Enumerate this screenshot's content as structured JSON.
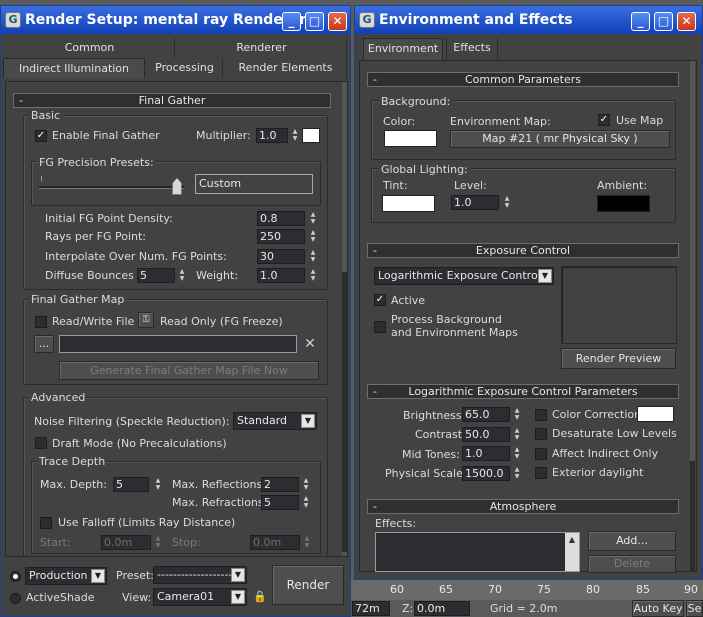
{
  "render_setup": {
    "title": "Render Setup: mental ray Renderer",
    "tabs": [
      "Common",
      "Renderer",
      "Indirect Illumination",
      "Processing",
      "Render Elements"
    ],
    "final_gather": {
      "header": "Final Gather",
      "basic_label": "Basic",
      "enable_label": "Enable Final Gather",
      "enable_checked": true,
      "multiplier_label": "Multiplier:",
      "multiplier_value": "1.0",
      "multiplier_color": "#ffffff",
      "presets_label": "FG Precision Presets:",
      "preset_value": "Custom",
      "preset_level": 1.0,
      "density_label": "Initial FG Point Density:",
      "density_value": "0.8",
      "rays_label": "Rays per FG Point:",
      "rays_value": "250",
      "interp_label": "Interpolate Over Num. FG Points:",
      "interp_value": "30",
      "bounces_label": "Diffuse Bounces",
      "bounces_value": "5",
      "weight_label": "Weight:",
      "weight_value": "1.0"
    },
    "fg_map": {
      "label": "Final Gather Map",
      "readwrite_label": "Read/Write File",
      "readonly_label": "Read Only (FG Freeze)",
      "browse_label": "...",
      "file_value": "",
      "generate_label": "Generate Final Gather Map File Now"
    },
    "advanced": {
      "label": "Advanced",
      "noise_label": "Noise Filtering (Speckle Reduction):",
      "noise_value": "Standard",
      "draft_label": "Draft Mode (No Precalculations)",
      "trace_label": "Trace Depth",
      "maxdepth_label": "Max. Depth:",
      "maxdepth_value": "5",
      "maxrefl_label": "Max. Reflections:",
      "maxrefl_value": "2",
      "maxrefr_label": "Max. Refractions:",
      "maxrefr_value": "5",
      "falloff_label": "Use Falloff (Limits Ray Distance)",
      "start_label": "Start:",
      "start_value": "0.0m",
      "stop_label": "Stop:",
      "stop_value": "0.0m"
    },
    "bottom": {
      "production_label": "Production",
      "activeshade_label": "ActiveShade",
      "preset_label": "Preset:",
      "preset_value": "--------------------",
      "view_label": "View:",
      "view_value": "Camera01",
      "render_label": "Render"
    }
  },
  "env_effects": {
    "title": "Environment and Effects",
    "tabs": [
      "Environment",
      "Effects"
    ],
    "common": {
      "header": "Common Parameters",
      "background_label": "Background:",
      "color_label": "Color:",
      "color_value": "#ffffff",
      "envmap_label": "Environment Map:",
      "usemap_label": "Use Map",
      "usemap_checked": true,
      "map_button": "Map #21  ( mr Physical Sky )",
      "global_label": "Global Lighting:",
      "tint_label": "Tint:",
      "tint_value": "#ffffff",
      "level_label": "Level:",
      "level_value": "1.0",
      "ambient_label": "Ambient:",
      "ambient_value": "#000000"
    },
    "exposure": {
      "header": "Exposure Control",
      "type_value": "Logarithmic Exposure Control",
      "active_label": "Active",
      "active_checked": true,
      "process_label_1": "Process Background",
      "process_label_2": "and Environment Maps",
      "preview_label": "Render Preview"
    },
    "log_params": {
      "header": "Logarithmic Exposure Control Parameters",
      "brightness_label": "Brightness:",
      "brightness_value": "65.0",
      "contrast_label": "Contrast:",
      "contrast_value": "50.0",
      "midtones_label": "Mid Tones:",
      "midtones_value": "1.0",
      "physscale_label": "Physical Scale:",
      "physscale_value": "1500.0",
      "colorcorr_label": "Color Correction:",
      "desat_label": "Desaturate Low Levels",
      "affect_label": "Affect Indirect Only",
      "exterior_label": "Exterior daylight"
    },
    "atmosphere": {
      "header": "Atmosphere",
      "effects_label": "Effects:",
      "add_label": "Add...",
      "delete_label": "Delete"
    }
  },
  "status": {
    "ruler": [
      "60",
      "65",
      "70",
      "75",
      "80",
      "85",
      "90"
    ],
    "left_value": "72m",
    "z_label": "Z:",
    "z_value": "0.0m",
    "grid_label": "Grid = 2.0m",
    "autokey_label": "Auto Key",
    "se_label": "Se"
  }
}
